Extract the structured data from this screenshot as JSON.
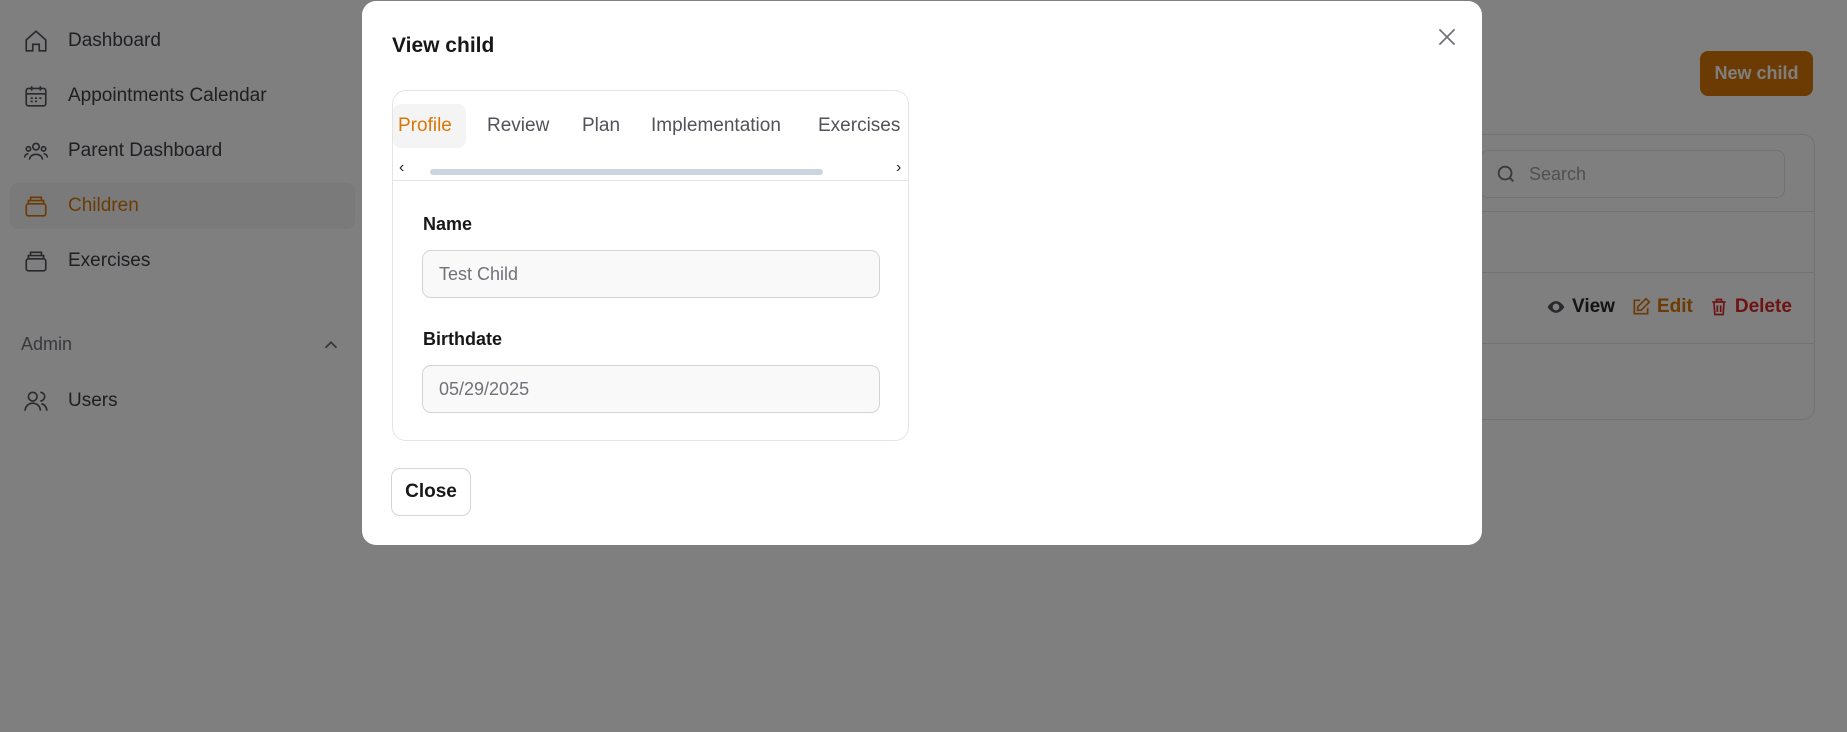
{
  "sidebar": {
    "items": [
      {
        "label": "Dashboard",
        "icon": "home-icon"
      },
      {
        "label": "Appointments Calendar",
        "icon": "calendar-icon"
      },
      {
        "label": "Parent Dashboard",
        "icon": "users-group-icon"
      },
      {
        "label": "Children",
        "icon": "stack-icon",
        "active": true
      },
      {
        "label": "Exercises",
        "icon": "stack-icon"
      }
    ],
    "admin_label": "Admin",
    "admin_items": [
      {
        "label": "Users",
        "icon": "users-icon"
      }
    ]
  },
  "header": {
    "new_child_label": "New child"
  },
  "table": {
    "search_placeholder": "Search",
    "row_actions": {
      "view": "View",
      "edit": "Edit",
      "delete": "Delete"
    }
  },
  "modal": {
    "title": "View child",
    "tabs": [
      {
        "label": "Profile",
        "active": true
      },
      {
        "label": "Review"
      },
      {
        "label": "Plan"
      },
      {
        "label": "Implementation"
      },
      {
        "label": "Exercises"
      }
    ],
    "scroll_left": "‹",
    "scroll_right": "›",
    "fields": {
      "name_label": "Name",
      "name_value": "Test Child",
      "birthdate_label": "Birthdate",
      "birthdate_value": "05/29/2025"
    },
    "close_label": "Close"
  },
  "colors": {
    "accent": "#d97706",
    "danger": "#dc2626",
    "overlay": "rgba(0,0,0,0.5)"
  }
}
